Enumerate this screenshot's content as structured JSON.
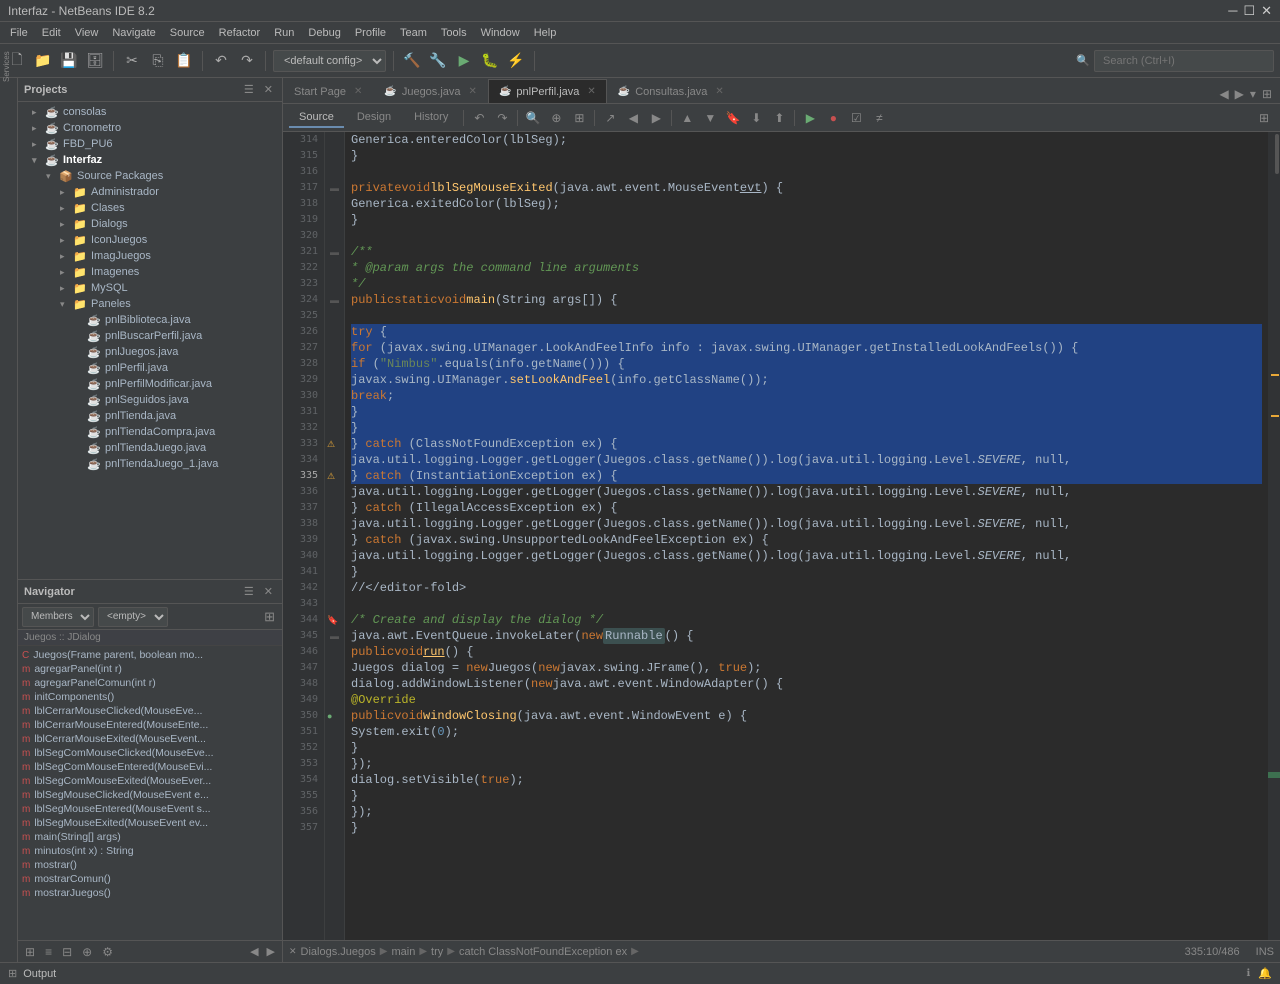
{
  "app": {
    "title": "Interfaz - NetBeans IDE 8.2",
    "window_controls": [
      "minimize",
      "maximize",
      "close"
    ]
  },
  "menubar": {
    "items": [
      "File",
      "Edit",
      "View",
      "Navigate",
      "Source",
      "Refactor",
      "Run",
      "Debug",
      "Profile",
      "Team",
      "Tools",
      "Window",
      "Help"
    ]
  },
  "toolbar": {
    "config": "<default config>",
    "search_placeholder": "Search (Ctrl+I)"
  },
  "projects_panel": {
    "title": "Projects",
    "items": [
      {
        "id": "consolas",
        "label": "consolas",
        "indent": 1,
        "type": "project",
        "expanded": true
      },
      {
        "id": "cronometro",
        "label": "Cronometro",
        "indent": 1,
        "type": "project",
        "expanded": false
      },
      {
        "id": "fbd_pu6",
        "label": "FBD_PU6",
        "indent": 1,
        "type": "project",
        "expanded": false
      },
      {
        "id": "interfaz",
        "label": "Interfaz",
        "indent": 1,
        "type": "project",
        "expanded": true,
        "active": true
      },
      {
        "id": "source-packages",
        "label": "Source Packages",
        "indent": 2,
        "type": "folder",
        "expanded": true
      },
      {
        "id": "administrador",
        "label": "Administrador",
        "indent": 3,
        "type": "package",
        "expanded": false
      },
      {
        "id": "clases",
        "label": "Clases",
        "indent": 3,
        "type": "package",
        "expanded": false
      },
      {
        "id": "dialogs",
        "label": "Dialogs",
        "indent": 3,
        "type": "package",
        "expanded": false
      },
      {
        "id": "iconjuegos",
        "label": "IconJuegos",
        "indent": 3,
        "type": "package",
        "expanded": false
      },
      {
        "id": "imagjuegos",
        "label": "ImagJuegos",
        "indent": 3,
        "type": "package",
        "expanded": false
      },
      {
        "id": "imagenes",
        "label": "Imagenes",
        "indent": 3,
        "type": "package",
        "expanded": false
      },
      {
        "id": "mysql",
        "label": "MySQL",
        "indent": 3,
        "type": "package",
        "expanded": false
      },
      {
        "id": "paneles",
        "label": "Paneles",
        "indent": 3,
        "type": "package",
        "expanded": true
      },
      {
        "id": "pnlbiblioteca",
        "label": "pnlBiblioteca.java",
        "indent": 4,
        "type": "java"
      },
      {
        "id": "pnlbuscarperfil",
        "label": "pnlBuscarPerfil.java",
        "indent": 4,
        "type": "java"
      },
      {
        "id": "pnljuegos",
        "label": "pnlJuegos.java",
        "indent": 4,
        "type": "java"
      },
      {
        "id": "pnlperfil",
        "label": "pnlPerfil.java",
        "indent": 4,
        "type": "java"
      },
      {
        "id": "pnlperfilmodificar",
        "label": "pnlPerfilModificar.java",
        "indent": 4,
        "type": "java"
      },
      {
        "id": "pnlseguidos",
        "label": "pnlSeguidos.java",
        "indent": 4,
        "type": "java"
      },
      {
        "id": "pnltienda",
        "label": "pnlTienda.java",
        "indent": 4,
        "type": "java"
      },
      {
        "id": "pnltiendacompra",
        "label": "pnlTiendaCompra.java",
        "indent": 4,
        "type": "java"
      },
      {
        "id": "pnltiendajuego",
        "label": "pnlTiendaJuego.java",
        "indent": 4,
        "type": "java"
      },
      {
        "id": "pnltiendajuego1",
        "label": "pnlTiendaJuego_1.java",
        "indent": 4,
        "type": "java"
      }
    ]
  },
  "navigator_panel": {
    "title": "Navigator",
    "filter_label": "Members",
    "filter2_label": "<empty>",
    "class_label": "Juegos :: JDialog",
    "items": [
      {
        "label": "Juegos(Frame parent, boolean mo...",
        "type": "constructor",
        "indent": 1
      },
      {
        "label": "agregarPanel(int r)",
        "type": "method",
        "indent": 1
      },
      {
        "label": "agregarPanelComun(int r)",
        "type": "method",
        "indent": 1
      },
      {
        "label": "initComponents()",
        "type": "method",
        "indent": 1
      },
      {
        "label": "lblCerrarMouseClicked(MouseEvent...",
        "type": "method",
        "indent": 1
      },
      {
        "label": "lblCerrarMouseEntered(MouseEnte...",
        "type": "method",
        "indent": 1
      },
      {
        "label": "lblCerrarMouseExited(MouseEvent...",
        "type": "method",
        "indent": 1
      },
      {
        "label": "lblSegComMouseClicked(MouseEve...",
        "type": "method",
        "indent": 1
      },
      {
        "label": "lblSegComMouseEntered(MouseEvi...",
        "type": "method",
        "indent": 1
      },
      {
        "label": "lblSegComMouseExited(MouseEver...",
        "type": "method",
        "indent": 1
      },
      {
        "label": "lblSegMouseClicked(MouseEvent e...",
        "type": "method",
        "indent": 1
      },
      {
        "label": "lblSegMouseEntered(MouseEvent s...",
        "type": "method",
        "indent": 1
      },
      {
        "label": "lblSegMouseExited(MouseEvent ev...",
        "type": "method",
        "indent": 1
      },
      {
        "label": "main(String[] args)",
        "type": "method",
        "indent": 1
      },
      {
        "label": "minutos(int x) : String",
        "type": "method",
        "indent": 1
      },
      {
        "label": "mostrar()",
        "type": "method",
        "indent": 1
      },
      {
        "label": "mostrarComun()",
        "type": "method",
        "indent": 1
      },
      {
        "label": "mostrarJuegos()",
        "type": "method",
        "indent": 1
      }
    ]
  },
  "editor": {
    "tabs": [
      {
        "label": "Start Page",
        "closable": true,
        "active": false
      },
      {
        "label": "Juegos.java",
        "closable": true,
        "active": false
      },
      {
        "label": "pnlPerfil.java",
        "closable": true,
        "active": true
      },
      {
        "label": "Consultas.java",
        "closable": true,
        "active": false
      }
    ],
    "toolbar_tabs": [
      "Source",
      "Design",
      "History"
    ],
    "active_tab": "Source",
    "lines": [
      {
        "num": 314,
        "code": "            Generica.enteredColor(lblSeg);",
        "type": "plain"
      },
      {
        "num": 315,
        "code": "        }",
        "type": "plain"
      },
      {
        "num": 316,
        "code": "",
        "type": "plain"
      },
      {
        "num": 317,
        "code": "    private void lblSegMouseExited(java.awt.event.MouseEvent evt) {",
        "type": "plain",
        "fold": true
      },
      {
        "num": 318,
        "code": "        Generica.exitedColor(lblSeg);",
        "type": "plain"
      },
      {
        "num": 319,
        "code": "    }",
        "type": "plain"
      },
      {
        "num": 320,
        "code": "",
        "type": "plain"
      },
      {
        "num": 321,
        "code": "    /**",
        "type": "comment",
        "fold": true
      },
      {
        "num": 322,
        "code": "     * @param args the command line arguments",
        "type": "comment"
      },
      {
        "num": 323,
        "code": "     */",
        "type": "comment"
      },
      {
        "num": 324,
        "code": "    public static void main(String args[]) {",
        "type": "plain",
        "fold": true
      },
      {
        "num": 325,
        "code": "",
        "type": "plain"
      },
      {
        "num": 326,
        "code": "        try {",
        "type": "selected"
      },
      {
        "num": 327,
        "code": "            for (javax.swing.UIManager.LookAndFeelInfo info : javax.swing.UIManager.getInstalledLookAndFeels()) {",
        "type": "selected"
      },
      {
        "num": 328,
        "code": "                if (\"Nimbus\".equals(info.getName())) {",
        "type": "selected"
      },
      {
        "num": 329,
        "code": "                    javax.swing.UIManager.setLookAndFeel(info.getClassName());",
        "type": "selected"
      },
      {
        "num": 330,
        "code": "                    break;",
        "type": "selected"
      },
      {
        "num": 331,
        "code": "                }",
        "type": "selected"
      },
      {
        "num": 332,
        "code": "            }",
        "type": "selected"
      },
      {
        "num": 333,
        "code": "        } catch (ClassNotFoundException ex) {",
        "type": "selected",
        "icon": "warning"
      },
      {
        "num": 334,
        "code": "            java.util.logging.Logger.getLogger(Juegos.class.getName()).log(java.util.logging.Level.SEVERE, null,",
        "type": "selected"
      },
      {
        "num": 335,
        "code": "        } catch (InstantiationException ex) {",
        "type": "selected",
        "icon": "warning"
      },
      {
        "num": 336,
        "code": "            java.util.logging.Logger.getLogger(Juegos.class.getName()).log(java.util.logging.Level.SEVERE, null,",
        "type": "plain"
      },
      {
        "num": 337,
        "code": "        } catch (IllegalAccessException ex) {",
        "type": "plain"
      },
      {
        "num": 338,
        "code": "            java.util.logging.Logger.getLogger(Juegos.class.getName()).log(java.util.logging.Level.SEVERE, null,",
        "type": "plain"
      },
      {
        "num": 339,
        "code": "        } catch (javax.swing.UnsupportedLookAndFeelException ex) {",
        "type": "plain"
      },
      {
        "num": 340,
        "code": "            java.util.logging.Logger.getLogger(Juegos.class.getName()).log(java.util.logging.Level.SEVERE, null,",
        "type": "plain"
      },
      {
        "num": 341,
        "code": "        }",
        "type": "plain"
      },
      {
        "num": 342,
        "code": "        //</editor-fold>",
        "type": "plain"
      },
      {
        "num": 343,
        "code": "",
        "type": "plain"
      },
      {
        "num": 344,
        "code": "        /* Create and display the dialog */",
        "type": "comment",
        "icon": "bookmark"
      },
      {
        "num": 345,
        "code": "        java.awt.EventQueue.invokeLater(new Runnable() {",
        "type": "plain",
        "fold": true
      },
      {
        "num": 346,
        "code": "            public void run() {",
        "type": "plain"
      },
      {
        "num": 347,
        "code": "                Juegos dialog = new Juegos(new javax.swing.JFrame(), true);",
        "type": "plain"
      },
      {
        "num": 348,
        "code": "                dialog.addWindowListener(new java.awt.event.WindowAdapter() {",
        "type": "plain"
      },
      {
        "num": 349,
        "code": "                    @Override",
        "type": "plain"
      },
      {
        "num": 350,
        "code": "                    public void windowClosing(java.awt.event.WindowEvent e) {",
        "type": "plain",
        "icon": "breakpoint"
      },
      {
        "num": 351,
        "code": "                        System.exit(0);",
        "type": "plain"
      },
      {
        "num": 352,
        "code": "                    }",
        "type": "plain"
      },
      {
        "num": 353,
        "code": "                });",
        "type": "plain"
      },
      {
        "num": 354,
        "code": "                dialog.setVisible(true);",
        "type": "plain"
      },
      {
        "num": 355,
        "code": "            }",
        "type": "plain"
      },
      {
        "num": 356,
        "code": "        });",
        "type": "plain"
      },
      {
        "num": 357,
        "code": "    }",
        "type": "plain"
      }
    ]
  },
  "statusbar": {
    "breadcrumb": [
      "Dialogs.Juegos",
      "main",
      "try",
      "catch ClassNotFoundException ex"
    ],
    "position": "335:10/486",
    "mode": "INS"
  },
  "output_bar": {
    "label": "Output"
  }
}
